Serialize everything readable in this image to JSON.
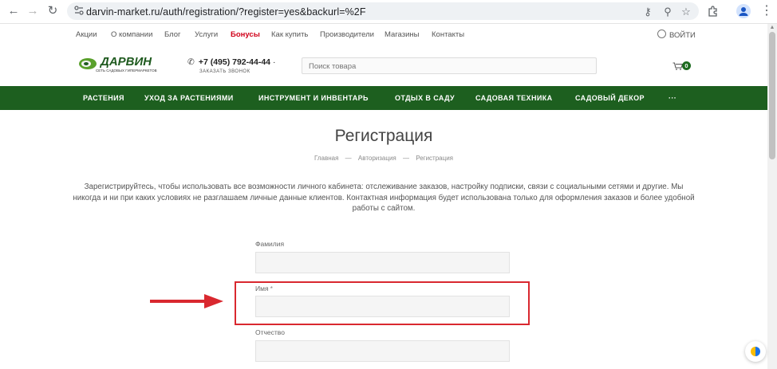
{
  "browser": {
    "url": "darvin-market.ru/auth/registration/?register=yes&backurl=%2F"
  },
  "top_links": [
    {
      "label": "Акции"
    },
    {
      "label": "О компании"
    },
    {
      "label": "Блог"
    },
    {
      "label": "Услуги"
    },
    {
      "label": "Бонусы"
    },
    {
      "label": "Как купить"
    },
    {
      "label": "Производители"
    },
    {
      "label": "Магазины"
    },
    {
      "label": "Контакты"
    }
  ],
  "login_label": "ВОЙТИ",
  "logo": {
    "title": "ДАРВИН",
    "subtitle": "СЕТЬ САДОВЫХ ГИПЕРМАРКЕТОВ"
  },
  "contact": {
    "phone": "+7 (495) 792-44-44",
    "callback": "ЗАКАЗАТЬ ЗВОНОК"
  },
  "search": {
    "placeholder": "Поиск товара"
  },
  "cart": {
    "count": "0"
  },
  "nav": [
    {
      "label": "РАСТЕНИЯ"
    },
    {
      "label": "УХОД ЗА РАСТЕНИЯМИ"
    },
    {
      "label": "ИНСТРУМЕНТ И ИНВЕНТАРЬ"
    },
    {
      "label": "ОТДЫХ В САДУ"
    },
    {
      "label": "САДОВАЯ ТЕХНИКА"
    },
    {
      "label": "САДОВЫЙ ДЕКОР"
    },
    {
      "label": "···"
    }
  ],
  "page": {
    "title": "Регистрация",
    "breadcrumbs": [
      "Главная",
      "Авторизация",
      "Регистрация"
    ],
    "breadcrumb_sep": "—",
    "intro": "Зарегистрируйтесь, чтобы использовать все возможности личного кабинета: отслеживание заказов, настройку подписки, связи с социальными сетями и другие. Мы никогда и ни при каких условиях не разглашаем личные данные клиентов. Контактная информация будет использована только для оформления заказов и более удобной работы с сайтом."
  },
  "form": {
    "fields": [
      {
        "label": "Фамилия",
        "required": "",
        "value": ""
      },
      {
        "label": "Имя",
        "required": "*",
        "value": ""
      },
      {
        "label": "Отчество",
        "required": "",
        "value": ""
      }
    ]
  },
  "colors": {
    "nav_green": "#1d5f1f",
    "accent_red": "#d9282f",
    "bonus_red": "#d0021b"
  }
}
